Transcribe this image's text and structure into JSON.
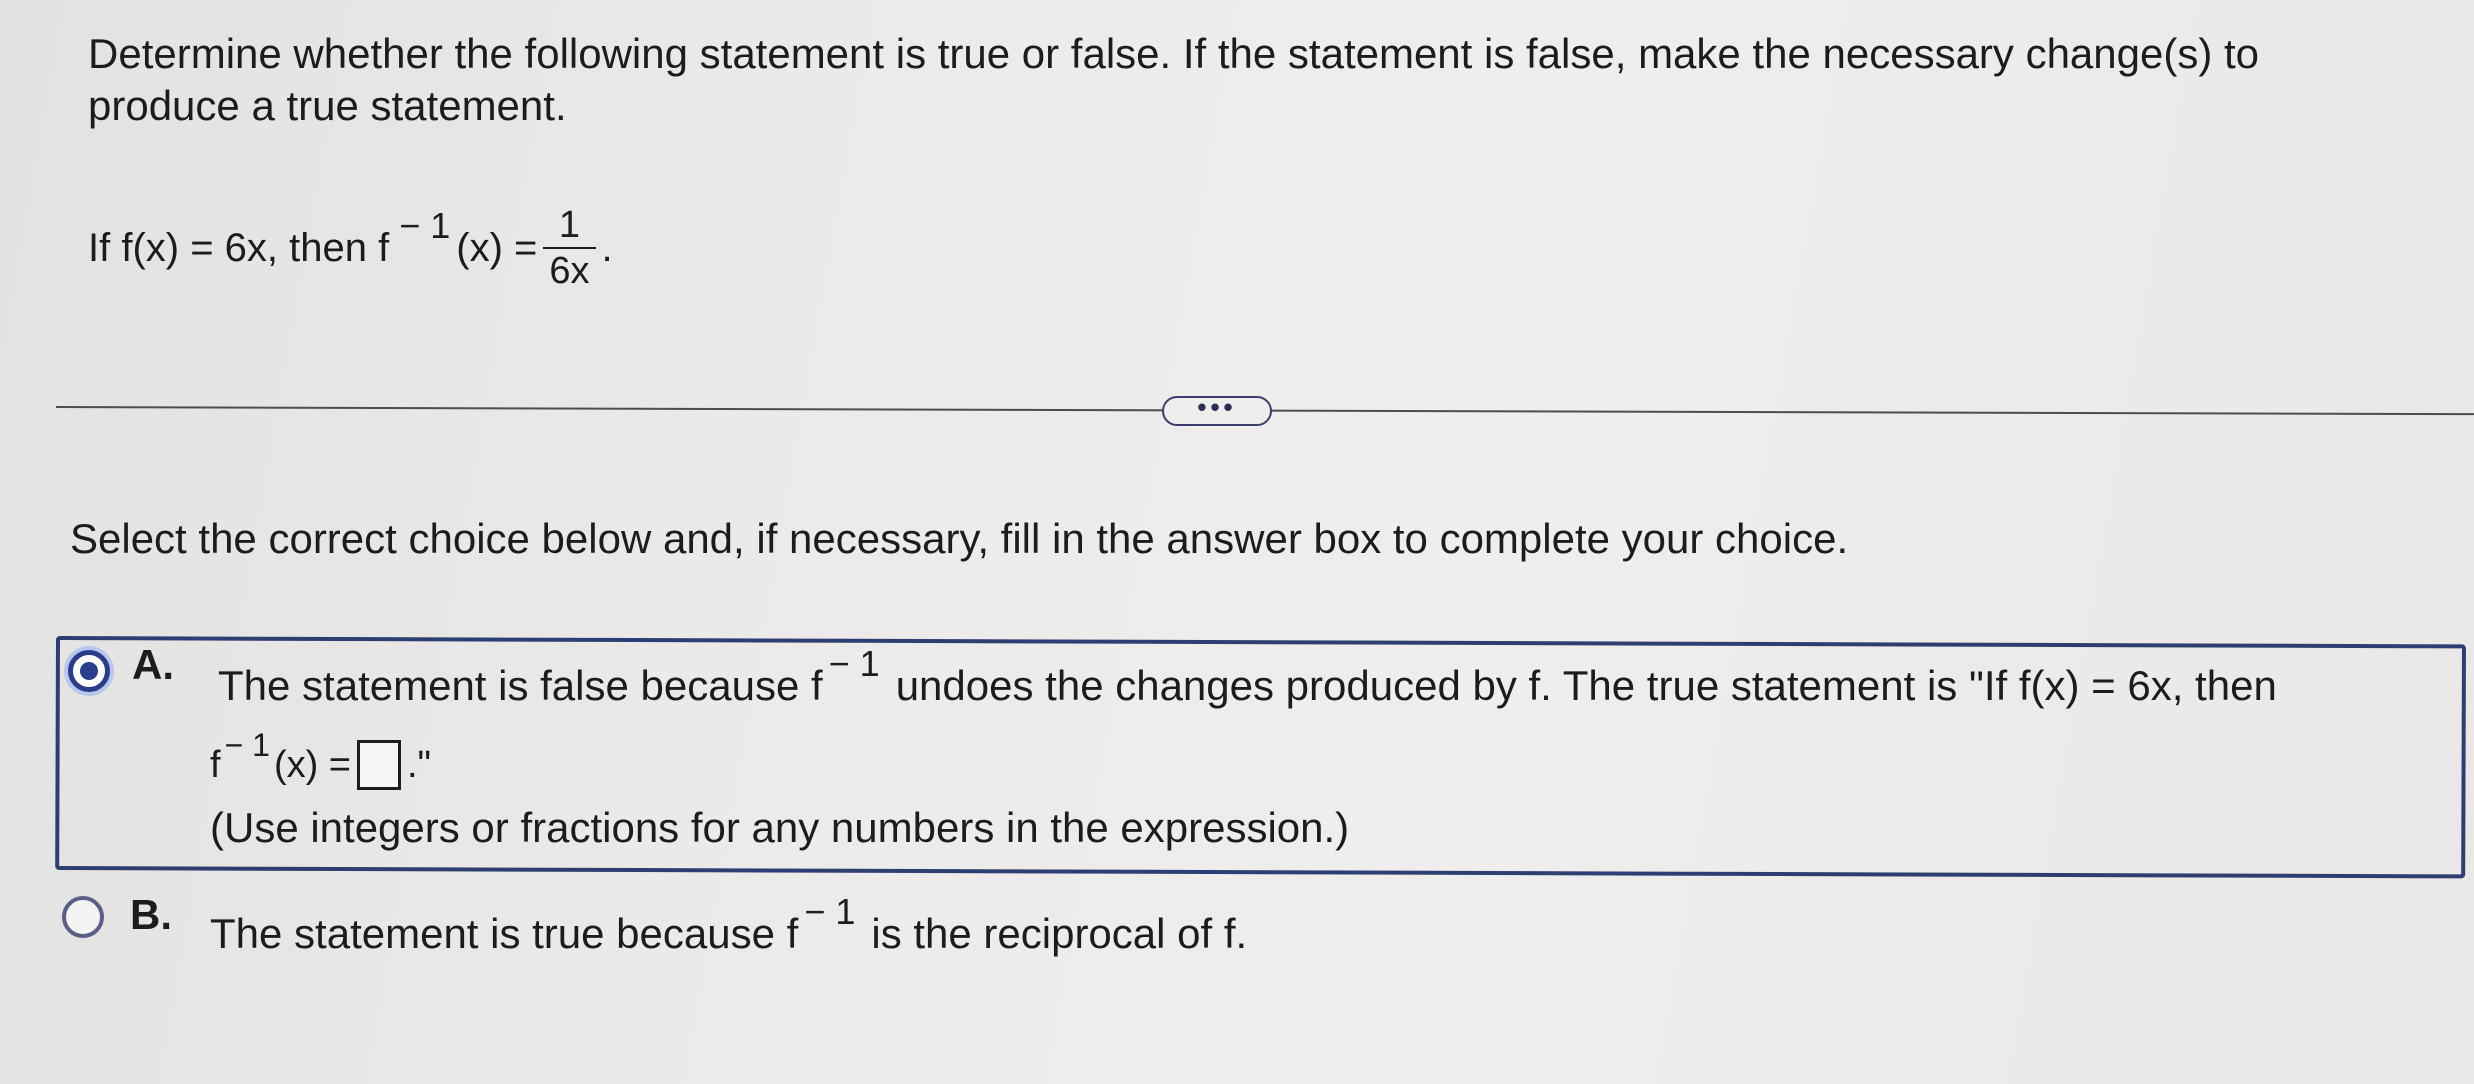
{
  "question": {
    "prompt": "Determine whether the following statement is true or false. If the statement is false, make the necessary change(s) to produce a true statement.",
    "statement_prefix": "If f(x) = 6x, then f",
    "statement_exponent": "− 1",
    "statement_middle": "(x) =",
    "fraction_numerator": "1",
    "fraction_denominator": "6x",
    "statement_suffix": "."
  },
  "more_button": {
    "label": "•••"
  },
  "instruction": "Select the correct choice below and, if necessary, fill in the answer box to complete your choice.",
  "choices": [
    {
      "letter": "A.",
      "selected": true,
      "text_before": "The statement is false because f",
      "exponent": "− 1",
      "text_after": "undoes the changes produced by f. The true statement is \"If f(x) = 6x, then",
      "answer_prefix": "f",
      "answer_exponent": "− 1",
      "answer_middle": "(x) =",
      "answer_value": "",
      "answer_suffix": ".\"",
      "hint": "(Use integers or fractions for any numbers in the expression.)"
    },
    {
      "letter": "B.",
      "selected": false,
      "text_before": "The statement is true because f",
      "exponent": "− 1",
      "text_after": "is the reciprocal of f."
    }
  ],
  "colors": {
    "accent": "#2a3d8a",
    "box_border": "#2e3e73",
    "text": "#1c1c1e"
  }
}
